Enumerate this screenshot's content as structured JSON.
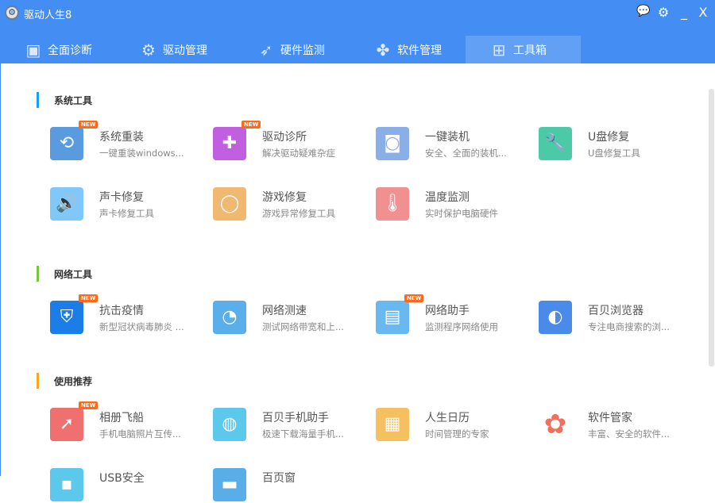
{
  "app": {
    "title": "驱动人生8"
  },
  "window_controls": {
    "feedback": "feedback-icon",
    "settings": "gear-icon",
    "minimize": "_",
    "close": "X"
  },
  "tabs": [
    {
      "label": "全面诊断",
      "icon": "monitor-pulse-icon",
      "glyph": "▣"
    },
    {
      "label": "驱动管理",
      "icon": "gear-icon",
      "glyph": "⚙"
    },
    {
      "label": "硬件监测",
      "icon": "rocket-icon",
      "glyph": "➶"
    },
    {
      "label": "软件管理",
      "icon": "flower-icon",
      "glyph": "✤"
    },
    {
      "label": "工具箱",
      "icon": "toolbox-icon",
      "glyph": "⊞"
    }
  ],
  "active_tab": "工具箱",
  "new_badge": "NEW",
  "sections": [
    {
      "title": "系统工具",
      "color": "#1a9cf0",
      "items": [
        {
          "name": "系统重装",
          "desc": "一键重装windows...",
          "new": true,
          "color": "#5a9be0",
          "glyph": "⟲",
          "icon": "reinstall-icon"
        },
        {
          "name": "驱动诊所",
          "desc": "解决驱动疑难杂症",
          "new": true,
          "color": "#c060e0",
          "glyph": "✚",
          "icon": "doctor-icon"
        },
        {
          "name": "一键装机",
          "desc": "安全、全面的装机...",
          "new": false,
          "color": "#8aaee8",
          "glyph": "◙",
          "icon": "computer-disc-icon"
        },
        {
          "name": "U盘修复",
          "desc": "U盘修复工具",
          "new": false,
          "color": "#4ccaa8",
          "glyph": "🔧",
          "icon": "usb-repair-icon"
        },
        {
          "name": "声卡修复",
          "desc": "声卡修复工具",
          "new": false,
          "color": "#80c8fa",
          "glyph": "🔊",
          "icon": "speaker-icon"
        },
        {
          "name": "游戏修复",
          "desc": "游戏异常修复工具",
          "new": false,
          "color": "#f0b870",
          "glyph": "◯",
          "icon": "game-ring-icon"
        },
        {
          "name": "温度监测",
          "desc": "实时保护电脑硬件",
          "new": false,
          "color": "#f09090",
          "glyph": "🌡",
          "icon": "thermometer-icon"
        }
      ]
    },
    {
      "title": "网络工具",
      "color": "#7cc440",
      "items": [
        {
          "name": "抗击疫情",
          "desc": "新型冠状病毒肺炎 ...",
          "new": true,
          "color": "#1a7de8",
          "glyph": "⛨",
          "icon": "shield-icon"
        },
        {
          "name": "网络测速",
          "desc": "测试网络带宽和上...",
          "new": false,
          "color": "#5aaeea",
          "glyph": "◔",
          "icon": "speedometer-icon"
        },
        {
          "name": "网络助手",
          "desc": "监测程序网络使用",
          "new": true,
          "color": "#6ab8f0",
          "glyph": "▤",
          "icon": "network-monitor-icon"
        },
        {
          "name": "百贝浏览器",
          "desc": "专注电商搜索的浏...",
          "new": false,
          "color": "#4a8ae8",
          "glyph": "◐",
          "icon": "browser-icon"
        }
      ]
    },
    {
      "title": "使用推荐",
      "color": "#f5a623",
      "items": [
        {
          "name": "相册飞船",
          "desc": "手机电脑照片互传...",
          "new": true,
          "color": "#f07070",
          "glyph": "➚",
          "icon": "photo-ship-icon"
        },
        {
          "name": "百贝手机助手",
          "desc": "极速下载海量手机...",
          "new": false,
          "color": "#5cc8ec",
          "glyph": "◍",
          "icon": "phone-assistant-icon"
        },
        {
          "name": "人生日历",
          "desc": "时间管理的专家",
          "new": false,
          "color": "#f4c060",
          "glyph": "▦",
          "icon": "calendar-icon"
        },
        {
          "name": "软件管家",
          "desc": "丰富、安全的软件...",
          "new": false,
          "color": "#ffffff",
          "glyph": "✿",
          "icon": "software-manager-icon"
        },
        {
          "name": "USB安全",
          "desc": "",
          "new": false,
          "color": "#5cc8ec",
          "glyph": "▪",
          "icon": "usb-security-icon"
        },
        {
          "name": "百页窗",
          "desc": "",
          "new": false,
          "color": "#5aaee8",
          "glyph": "▬",
          "icon": "folder-icon"
        }
      ]
    }
  ]
}
